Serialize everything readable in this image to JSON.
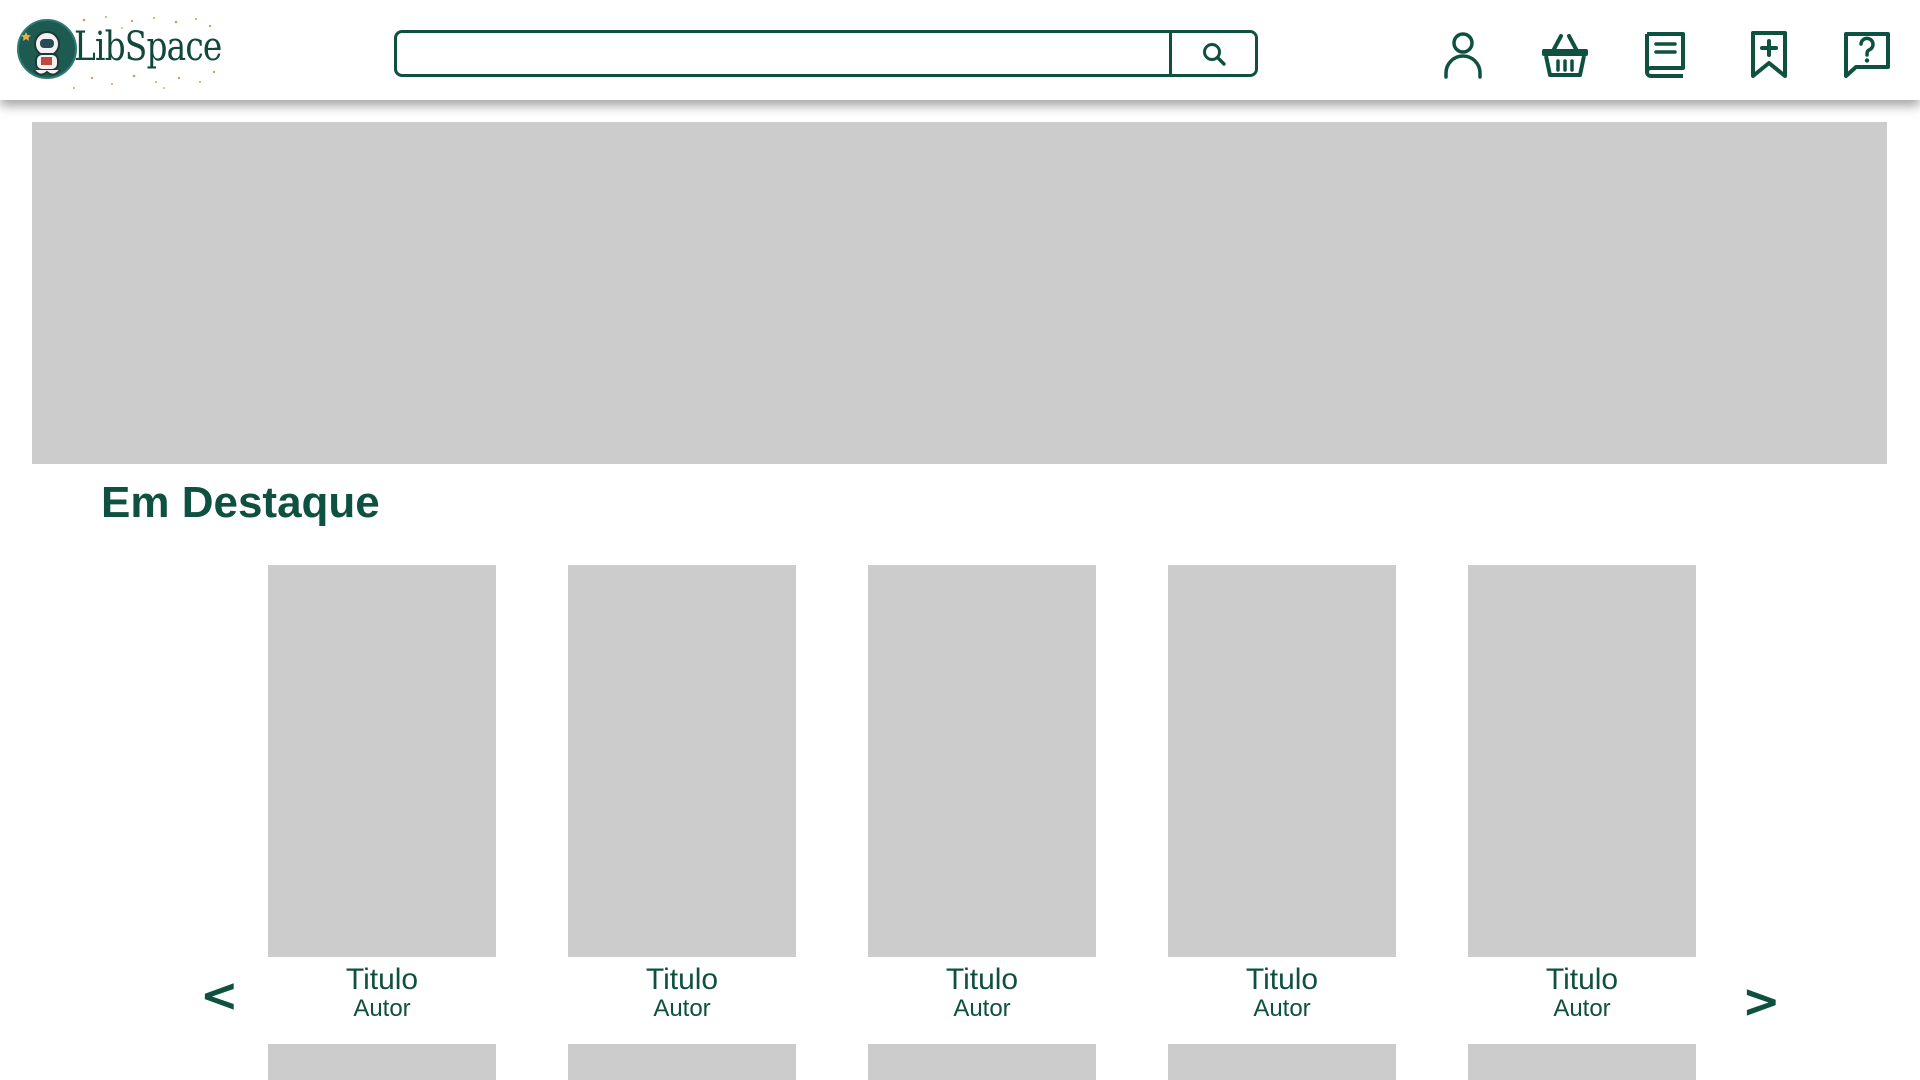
{
  "header": {
    "brand": "LibSpace",
    "search": {
      "value": "",
      "placeholder": ""
    },
    "icons": [
      "user-icon",
      "basket-icon",
      "book-icon",
      "bookmark-add-icon",
      "help-icon"
    ]
  },
  "featured": {
    "title": "Em Destaque",
    "prev_label": "<",
    "next_label": ">",
    "books": [
      {
        "title": "Titulo",
        "author": "Autor"
      },
      {
        "title": "Titulo",
        "author": "Autor"
      },
      {
        "title": "Titulo",
        "author": "Autor"
      },
      {
        "title": "Titulo",
        "author": "Autor"
      },
      {
        "title": "Titulo",
        "author": "Autor"
      }
    ]
  },
  "colors": {
    "primary": "#0f5140",
    "placeholder": "#cccccc",
    "background": "#ffffff"
  }
}
